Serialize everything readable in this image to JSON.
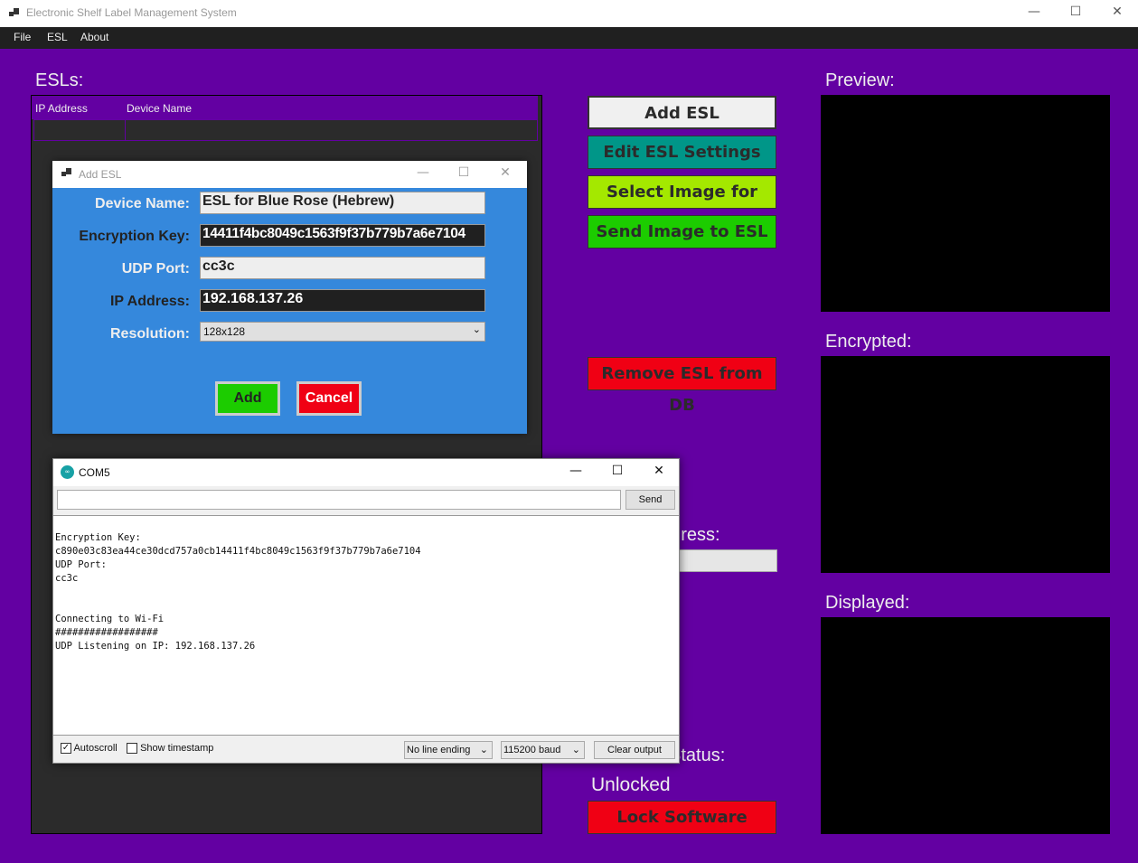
{
  "window": {
    "title": "Electronic Shelf Label Management System",
    "minimize": "—",
    "maximize": "☐",
    "close": "✕"
  },
  "menu": [
    "File",
    "ESL",
    "About"
  ],
  "esl_list": {
    "title": "ESLs:",
    "columns": [
      "IP Address",
      "Device Name"
    ]
  },
  "buttons": {
    "add": "Add ESL",
    "edit": "Edit ESL Settings",
    "select_image": "Select Image for ESL",
    "send_image": "Send Image to ESL",
    "remove": "Remove ESL from DB",
    "lock": "Lock Software"
  },
  "button_colors": {
    "add": "#f0f0f0",
    "edit": "#009688",
    "select_image": "#a4e800",
    "send_image": "#1ccc00",
    "remove": "#f00014",
    "lock": "#f00014"
  },
  "progress": {
    "label": "Progress:",
    "value": 0
  },
  "status": {
    "label": "Status:",
    "value": "Unlocked"
  },
  "previews": {
    "preview": "Preview:",
    "encrypted": "Encrypted:",
    "displayed": "Displayed:"
  },
  "add_dialog": {
    "title": "Add ESL",
    "fields": [
      {
        "label": "Device Name:",
        "value": "ESL for Blue Rose (Hebrew)"
      },
      {
        "label": "Encryption Key:",
        "value": "14411f4bc8049c1563f9f37b779b7a6e7104"
      },
      {
        "label": "UDP Port:",
        "value": "cc3c"
      },
      {
        "label": "IP Address:",
        "value": "192.168.137.26"
      },
      {
        "label": "Resolution:",
        "value": "128x128"
      }
    ],
    "add": "Add",
    "cancel": "Cancel"
  },
  "serial": {
    "title": "COM5",
    "send": "Send",
    "input": "",
    "output": "\nEncryption Key:\nc890e03c83ea44ce30dcd757a0cb14411f4bc8049c1563f9f37b779b7a6e7104\nUDP Port:\ncc3c\n\n\nConnecting to Wi-Fi\n##################\nUDP Listening on IP: 192.168.137.26",
    "autoscroll": "Autoscroll",
    "autoscroll_checked": true,
    "timestamp": "Show timestamp",
    "timestamp_checked": false,
    "line_ending": "No line ending",
    "baud": "115200 baud",
    "clear": "Clear output"
  }
}
